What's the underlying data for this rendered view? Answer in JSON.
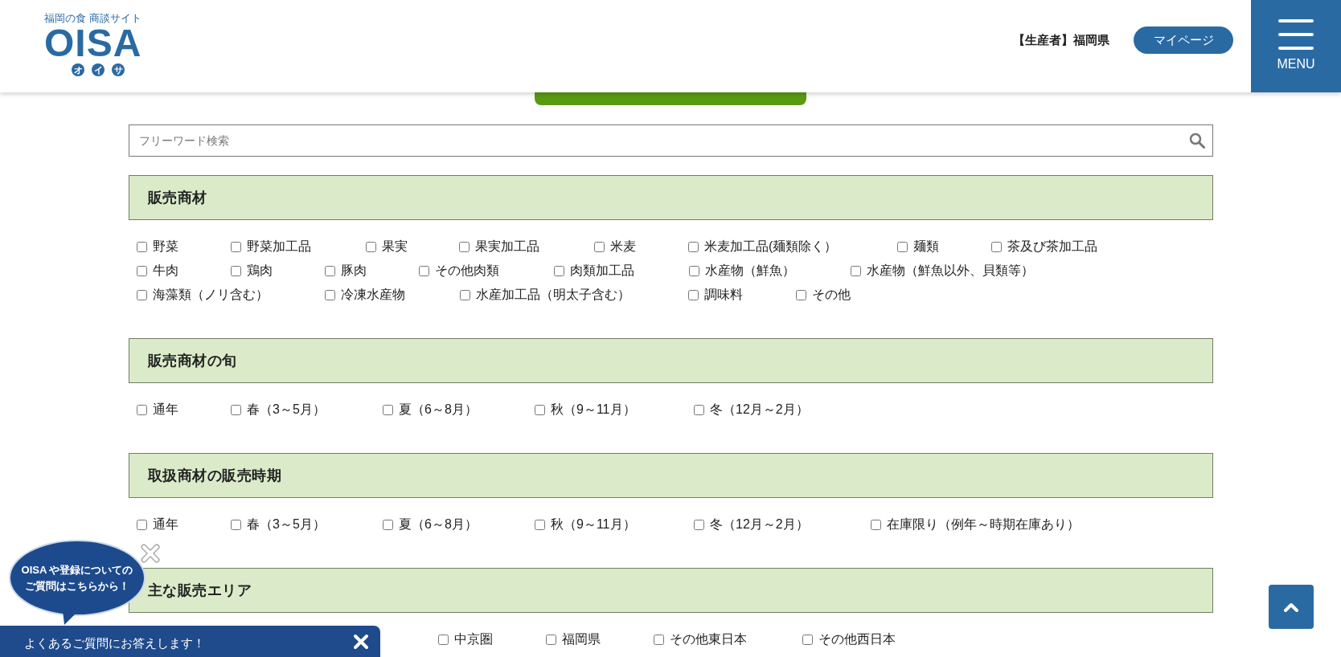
{
  "header": {
    "logo": {
      "tagline": "福岡の食 商談サイト",
      "name": "OISA",
      "kana": [
        "オ",
        "イ",
        "サ"
      ]
    },
    "user_label": "【生産者】福岡県",
    "mypage_button": "マイページ",
    "menu_label": "MENU"
  },
  "search": {
    "placeholder": "フリーワード検索"
  },
  "sections": [
    {
      "title": "販売商材",
      "options": [
        {
          "label": "野菜",
          "checked": false
        },
        {
          "label": "野菜加工品",
          "checked": false
        },
        {
          "label": "果実",
          "checked": false
        },
        {
          "label": "果実加工品",
          "checked": false
        },
        {
          "label": "米麦",
          "checked": false
        },
        {
          "label": "米麦加工品(麺類除く）",
          "checked": false
        },
        {
          "label": "麺類",
          "checked": false
        },
        {
          "label": "茶及び茶加工品",
          "checked": false
        },
        {
          "label": "牛肉",
          "checked": false
        },
        {
          "label": "鶏肉",
          "checked": false
        },
        {
          "label": "豚肉",
          "checked": false
        },
        {
          "label": "その他肉類",
          "checked": false
        },
        {
          "label": "肉類加工品",
          "checked": false
        },
        {
          "label": "水産物（鮮魚）",
          "checked": false
        },
        {
          "label": "水産物（鮮魚以外、貝類等）",
          "checked": false
        },
        {
          "label": "海藻類（ノリ含む）",
          "checked": false
        },
        {
          "label": "冷凍水産物",
          "checked": false
        },
        {
          "label": "水産加工品（明太子含む）",
          "checked": false
        },
        {
          "label": "調味料",
          "checked": false
        },
        {
          "label": "その他",
          "checked": false
        }
      ]
    },
    {
      "title": "販売商材の旬",
      "options": [
        {
          "label": "通年",
          "checked": false
        },
        {
          "label": "春（3～5月）",
          "checked": false
        },
        {
          "label": "夏（6～8月）",
          "checked": false
        },
        {
          "label": "秋（9～11月）",
          "checked": false
        },
        {
          "label": "冬（12月～2月）",
          "checked": false
        }
      ]
    },
    {
      "title": "取扱商材の販売時期",
      "options": [
        {
          "label": "通年",
          "checked": false
        },
        {
          "label": "春（3～5月）",
          "checked": false
        },
        {
          "label": "夏（6～8月）",
          "checked": false
        },
        {
          "label": "秋（9～11月）",
          "checked": false
        },
        {
          "label": "冬（12月～2月）",
          "checked": false
        },
        {
          "label": "在庫限り（例年～時期在庫あり）",
          "checked": false
        }
      ]
    },
    {
      "title": "主な販売エリア",
      "options": [
        {
          "label": "中京圏",
          "checked": false
        },
        {
          "label": "福岡県",
          "checked": false
        },
        {
          "label": "その他東日本",
          "checked": false
        },
        {
          "label": "その他西日本",
          "checked": false
        }
      ]
    }
  ],
  "chat": {
    "bubble_lines": [
      "OISA や登録についての",
      "ご質問はこちらから！"
    ],
    "bar_text": "よくあるご質問にお答えします！"
  }
}
